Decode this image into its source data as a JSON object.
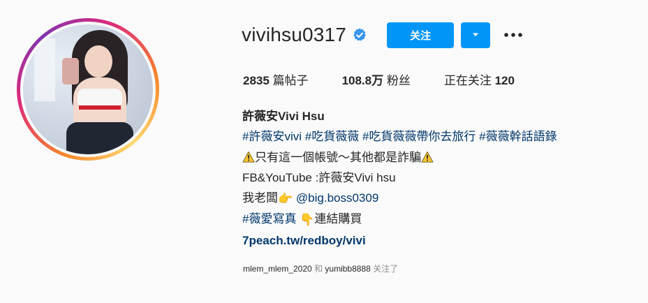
{
  "profile": {
    "username": "vivihsu0317",
    "follow_label": "关注",
    "stats": [
      {
        "value": "2835",
        "label": "篇帖子"
      },
      {
        "value": "108.8万",
        "label": "粉丝"
      },
      {
        "label": "正在关注",
        "value": "120"
      }
    ],
    "bio": {
      "name": "許薇安Vivi Hsu",
      "hashtags": [
        "#許薇安vivi",
        "#吃貨薇薇",
        "#吃貨薇薇帶你去旅行",
        "#薇薇幹話語錄"
      ],
      "warning_text": "只有這一個帳號～其他都是詐騙",
      "social_text": "FB&YouTube :許薇安Vivi hsu",
      "boss_prefix": "我老闆",
      "boss_handle": "@big.boss0309",
      "photo_tag": "#薇愛寫真",
      "purchase_text": "連結購買",
      "website": "7peach.tw/redboy/vivi"
    },
    "followed_by": {
      "user1": "mlem_mlem_2020",
      "conjunction": "和",
      "user2": "yumibb8888",
      "suffix": "关注了"
    }
  },
  "icons": {
    "verified": "verified-badge-icon",
    "dropdown": "chevron-down-icon",
    "more": "more-options-icon",
    "warning": "warning-icon",
    "point_right": "pointing-right-emoji",
    "point_down": "pointing-down-emoji"
  },
  "colors": {
    "accent": "#0095f6",
    "link": "#00376b",
    "text": "#262626",
    "muted": "#8e8e8e",
    "verified": "#3897f0"
  }
}
